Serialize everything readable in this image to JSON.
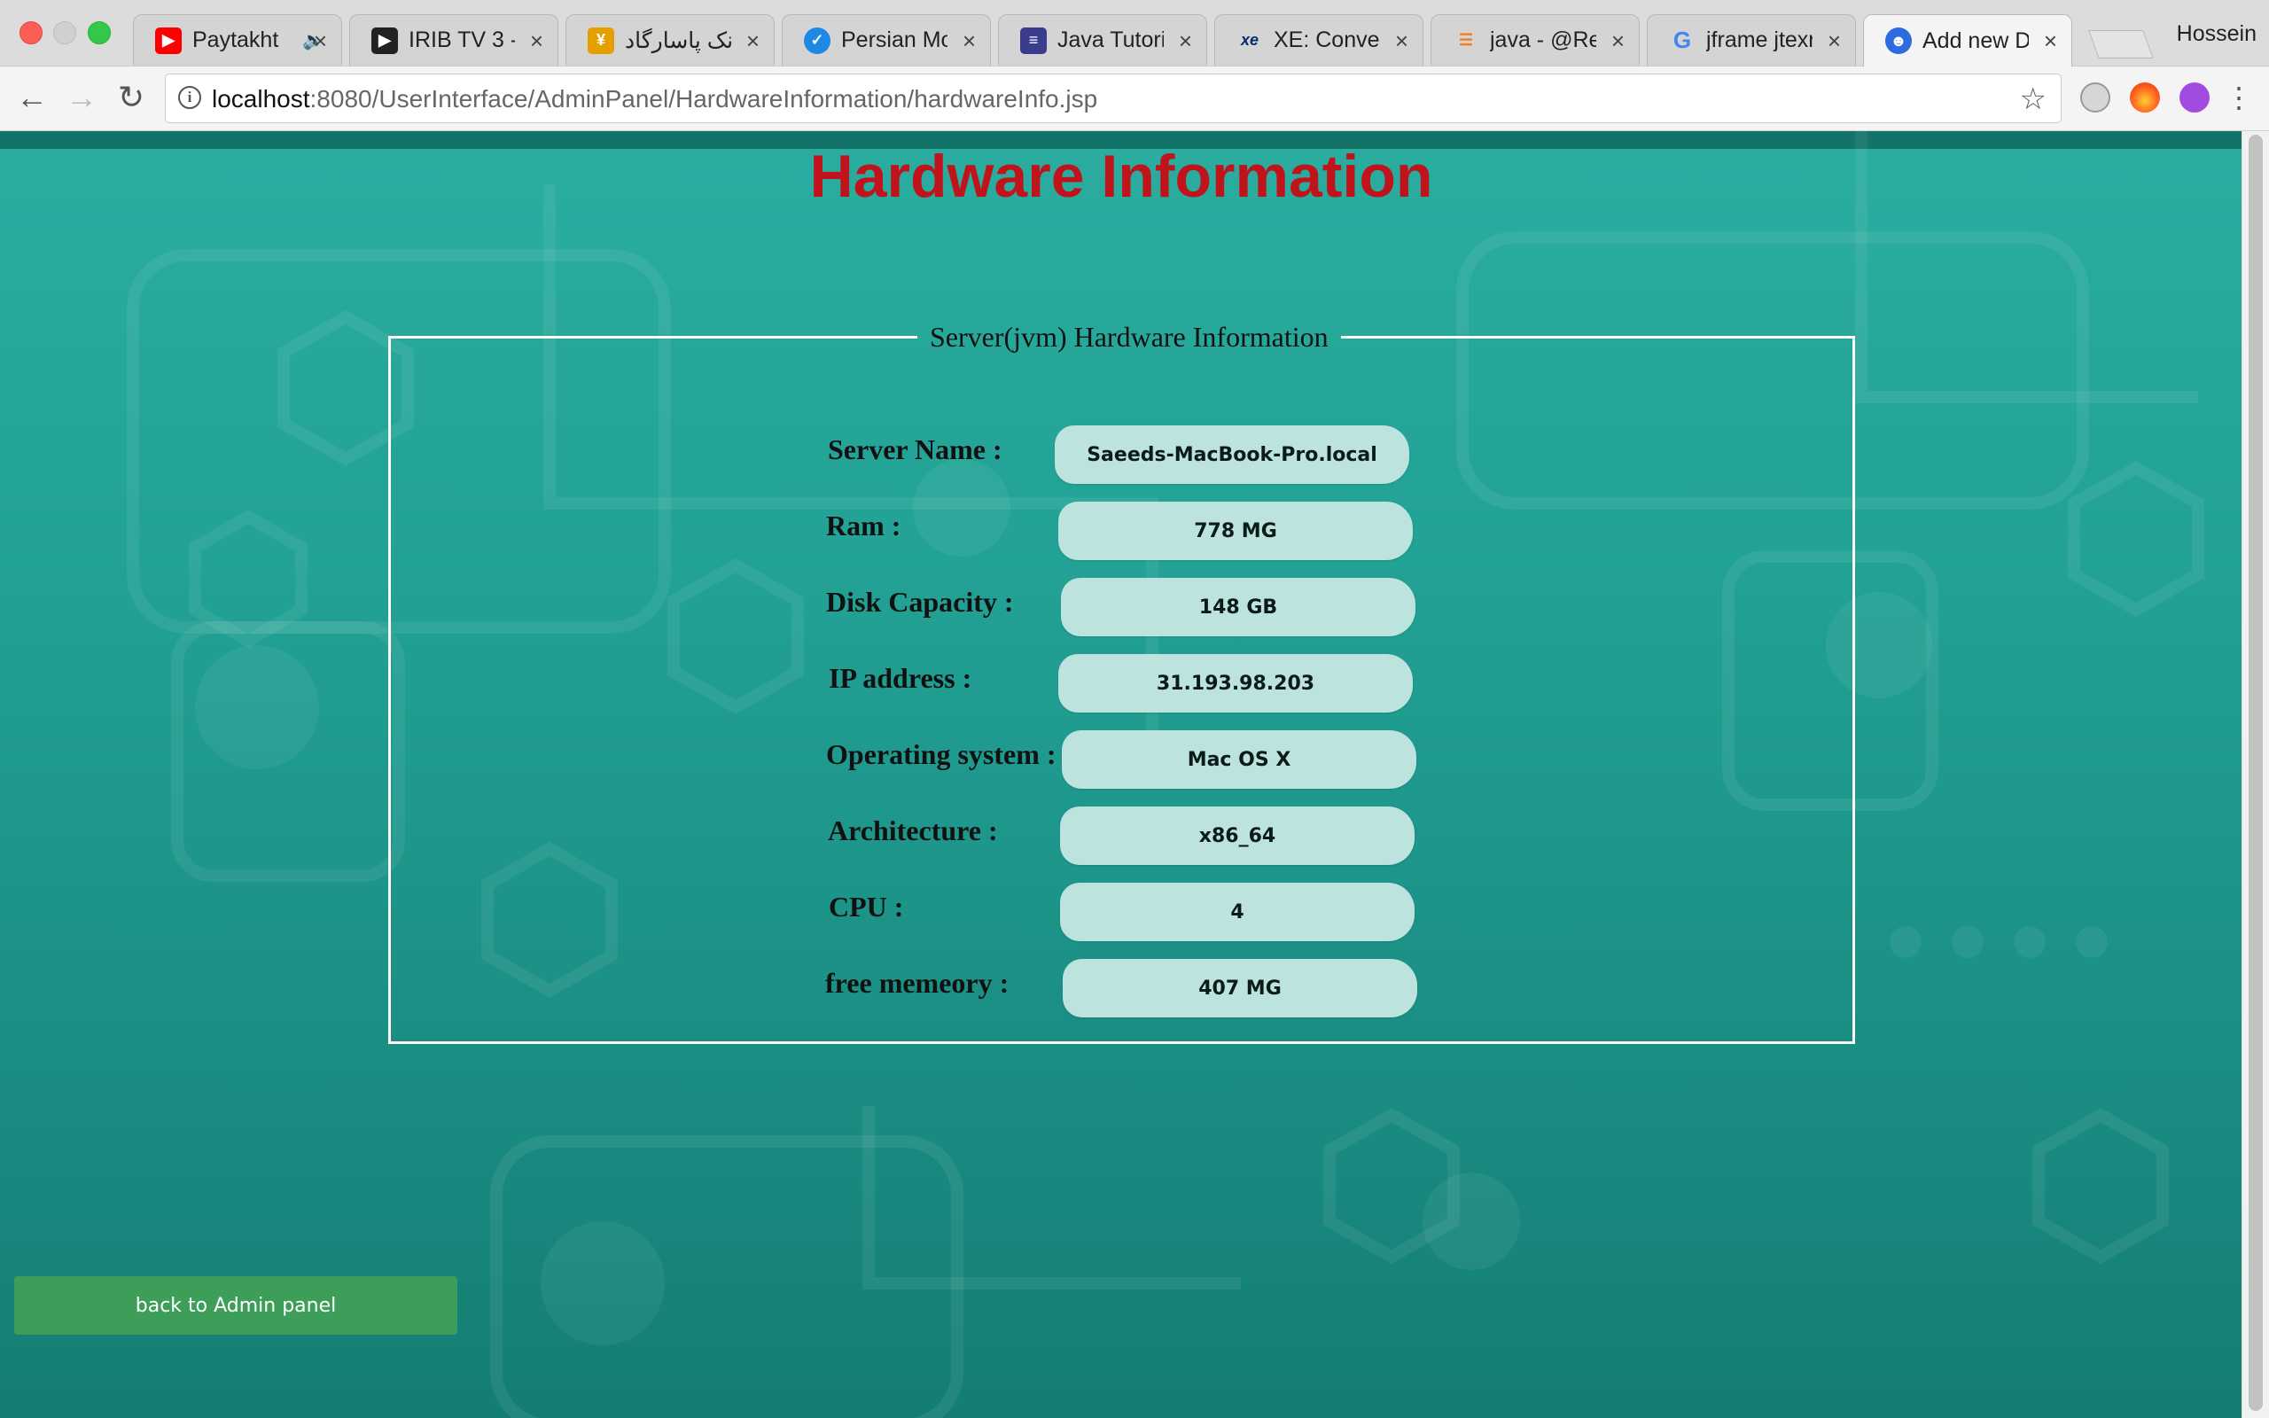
{
  "browser": {
    "tabs": [
      {
        "title": "Paytakht",
        "favicon": "youtube-icon",
        "color": "#ff0000",
        "muted": true
      },
      {
        "title": "IRIB TV 3 - ",
        "favicon": "play-icon",
        "color": "#222222"
      },
      {
        "title": "بانک پاسارگاد ::",
        "favicon": "bank-icon",
        "color": "#e5a000"
      },
      {
        "title": "Persian Mov",
        "favicon": "globe-icon",
        "color": "#1e88e5"
      },
      {
        "title": "Java Tutoria",
        "favicon": "code-icon",
        "color": "#3b3b8f"
      },
      {
        "title": "XE: Convert",
        "favicon": "xe-icon",
        "color": "#0a2d6e"
      },
      {
        "title": "java - @Req",
        "favicon": "stackoverflow-icon",
        "color": "#f48024"
      },
      {
        "title": "jframe jtexr",
        "favicon": "google-icon",
        "color": "#4285f4"
      },
      {
        "title": "Add new De",
        "favicon": "user-icon",
        "color": "#2d6cdf",
        "active": true
      }
    ],
    "profile_name": "Hossein",
    "url_host": "localhost",
    "url_rest": ":8080/UserInterface/AdminPanel/HardwareInformation/hardwareInfo.jsp"
  },
  "page": {
    "title": "Hardware Information",
    "box_legend": "Server(jvm) Hardware Information",
    "rows": [
      {
        "label": "Server Name :",
        "value": "Saeeds-MacBook-Pro.local"
      },
      {
        "label": "Ram :",
        "value": "778 MG"
      },
      {
        "label": "Disk Capacity :",
        "value": "148 GB"
      },
      {
        "label": "IP address :",
        "value": "31.193.98.203"
      },
      {
        "label": "Operating system :",
        "value": "Mac OS X"
      },
      {
        "label": "Architecture :",
        "value": "x86_64"
      },
      {
        "label": "CPU :",
        "value": "4"
      },
      {
        "label": "free memeory :",
        "value": "407 MG"
      }
    ],
    "back_button": "back to Admin panel"
  },
  "colors": {
    "title": "#c0141c",
    "page_bg": "#1f9a8e",
    "value_pill": "#bde3df",
    "back_button": "#3d9e5a"
  }
}
